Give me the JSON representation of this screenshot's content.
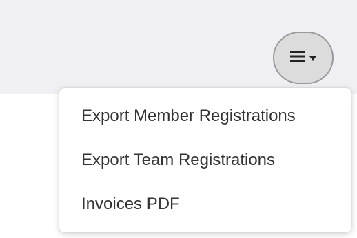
{
  "toolbar": {
    "menu_button": {
      "icon": "hamburger-icon",
      "caret": "caret-down-icon"
    }
  },
  "dropdown": {
    "items": [
      {
        "label": "Export Member Registrations"
      },
      {
        "label": "Export Team Registrations"
      },
      {
        "label": "Invoices PDF"
      }
    ]
  },
  "colors": {
    "header_background": "#f0f0f4",
    "button_background": "#dcdcdc",
    "button_border": "#9a9a9a",
    "menu_text": "#333333"
  }
}
